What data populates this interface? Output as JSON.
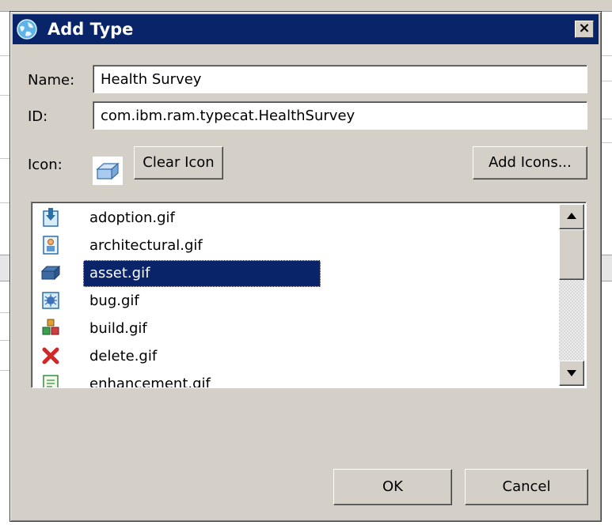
{
  "dialog": {
    "title": "Add Type",
    "close_label": "×"
  },
  "form": {
    "name_label": "Name:",
    "name_value": "Health Survey",
    "id_label": "ID:",
    "id_value": "com.ibm.ram.typecat.HealthSurvey",
    "icon_label": "Icon:",
    "selected_icon": "asset-icon",
    "clear_icon_button": "Clear Icon",
    "add_icons_button": "Add Icons..."
  },
  "icon_list": {
    "items": [
      {
        "label": "adoption.gif",
        "icon": "adoption-icon",
        "selected": false
      },
      {
        "label": "architectural.gif",
        "icon": "architectural-icon",
        "selected": false
      },
      {
        "label": "asset.gif",
        "icon": "asset-icon",
        "selected": true
      },
      {
        "label": "bug.gif",
        "icon": "bug-icon",
        "selected": false
      },
      {
        "label": "build.gif",
        "icon": "build-icon",
        "selected": false
      },
      {
        "label": "delete.gif",
        "icon": "delete-icon",
        "selected": false
      },
      {
        "label": "enhancement.gif",
        "icon": "enhancement-icon",
        "selected": false
      }
    ]
  },
  "buttons": {
    "ok": "OK",
    "cancel": "Cancel"
  },
  "colors": {
    "title_bar": "#0a246a",
    "dialog_face": "#d4d0c8",
    "selection": "#0a246a"
  }
}
